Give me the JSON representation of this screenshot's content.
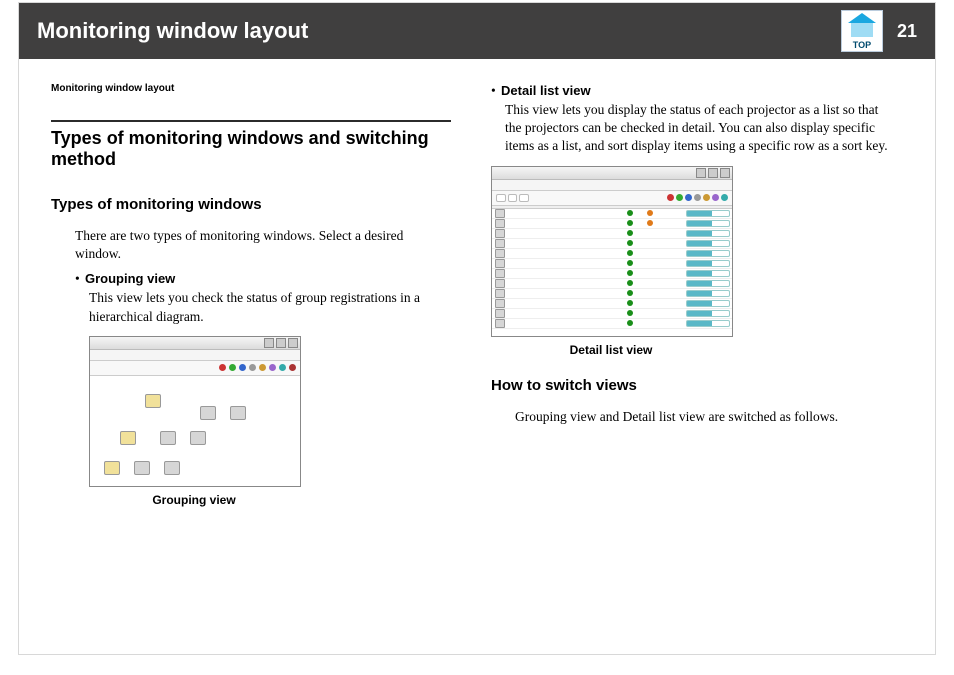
{
  "header": {
    "title": "Monitoring window layout",
    "top_icon_label": "TOP",
    "page_number": "21"
  },
  "left": {
    "breadcrumb": "Monitoring window layout",
    "section_heading": "Types of monitoring windows and switching method",
    "sub_heading": "Types of monitoring windows",
    "intro_text": "There are two types of monitoring windows.  Select a desired window.",
    "bullet1_label": "Grouping view",
    "bullet1_desc": "This view lets you check the status of group registrations in a hierarchical diagram.",
    "figure1_caption": "Grouping view"
  },
  "right": {
    "bullet2_label": "Detail list view",
    "bullet2_desc": "This view lets you display the status of each projector as a list so that the projectors can be checked in detail. You can also display specific items as a list, and sort display items using a specific row as a sort key.",
    "figure2_caption": "Detail list view",
    "sub_heading2": "How to switch views",
    "switch_text": "Grouping view and Detail list view are switched as follows."
  }
}
